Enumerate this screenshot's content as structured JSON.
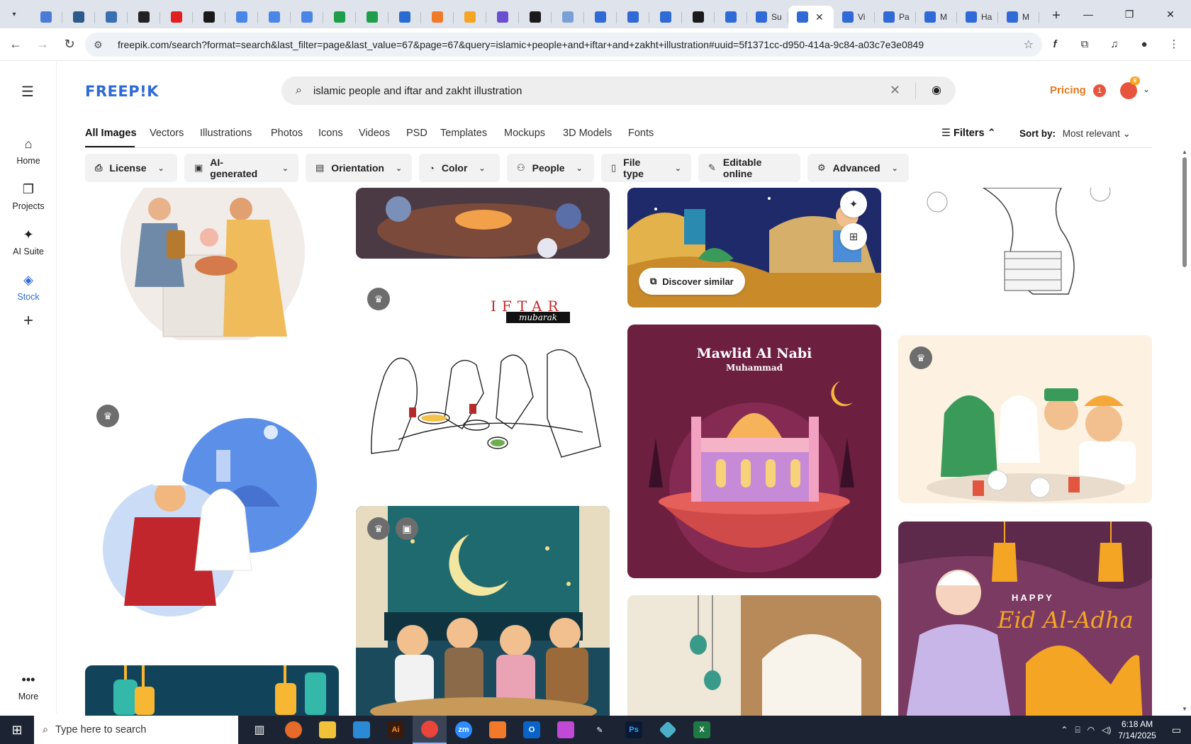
{
  "browser": {
    "tabs": [
      {
        "fav": "#4a7bd6"
      },
      {
        "fav": "#2d5a8a"
      },
      {
        "fav": "#3a6fb0"
      },
      {
        "fav": "#222222"
      },
      {
        "fav": "#e02020"
      },
      {
        "fav": "#1a1a1a"
      },
      {
        "fav": "#4a86e8"
      },
      {
        "fav": "#4a86e8"
      },
      {
        "fav": "#4a86e8"
      },
      {
        "fav": "#1e9e48"
      },
      {
        "fav": "#1e9e48"
      },
      {
        "fav": "#2a6bd1"
      },
      {
        "fav": "#f07a2a"
      },
      {
        "fav": "#f5a524"
      },
      {
        "fav": "#6b4fd1"
      },
      {
        "fav": "#1a1a1a"
      },
      {
        "fav": "#7aa0d8"
      },
      {
        "fav": "#2f6ad6"
      },
      {
        "fav": "#2f6ad6"
      },
      {
        "fav": "#2f6ad6"
      },
      {
        "fav": "#1a1a1a"
      },
      {
        "fav": "#2f6ad6"
      }
    ],
    "titled_tabs": [
      {
        "title": "Su"
      }
    ],
    "active_tab": {
      "title": ""
    },
    "after_tabs": [
      {
        "title": "Vi"
      },
      {
        "title": "Pa"
      },
      {
        "title": "M"
      },
      {
        "title": "Ha"
      },
      {
        "title": "M"
      }
    ],
    "new_tab": "+",
    "url": "freepik.com/search?format=search&last_filter=page&last_value=67&page=67&query=islamic+people+and+iftar+and+zakht+illustration#uuid=5f1371cc-d950-414a-9c84-a03c7e3e0849"
  },
  "sidebar": {
    "items": [
      {
        "label": "Home",
        "icon": "home-icon"
      },
      {
        "label": "Projects",
        "icon": "folder-icon"
      },
      {
        "label": "AI Suite",
        "icon": "sparkle-icon"
      },
      {
        "label": "Stock",
        "icon": "stock-icon"
      }
    ],
    "more": "More"
  },
  "header": {
    "logo": "FREEP!K",
    "search_query": "islamic people and iftar and zakht illustration",
    "pricing": "Pricing",
    "notif_count": "1"
  },
  "categories": [
    "All Images",
    "Vectors",
    "Illustrations",
    "Photos",
    "Icons",
    "Videos",
    "PSD",
    "Templates",
    "Mockups",
    "3D Models",
    "Fonts"
  ],
  "filters_label": "Filters",
  "sort": {
    "label": "Sort by:",
    "value": "Most relevant"
  },
  "chips": [
    {
      "label": "License",
      "icon": "license-icon"
    },
    {
      "label": "AI-generated",
      "icon": "ai-icon"
    },
    {
      "label": "Orientation",
      "icon": "orientation-icon"
    },
    {
      "label": "Color",
      "icon": "palette-icon"
    },
    {
      "label": "People",
      "icon": "people-icon"
    },
    {
      "label": "File type",
      "icon": "file-icon"
    },
    {
      "label": "Editable online",
      "icon": "pencil-icon"
    },
    {
      "label": "Advanced",
      "icon": "gear-icon"
    }
  ],
  "cards": {
    "discover_similar": "Discover similar",
    "iftar_title": "IFTAR",
    "iftar_sub": "mubarak",
    "mawlid_title": "Mawlid Al Nabi",
    "mawlid_sub": "Muhammad",
    "eid_happy": "HAPPY",
    "eid_title": "Eid Al-Adha"
  },
  "taskbar": {
    "search_placeholder": "Type here to search",
    "time": "6:18 AM",
    "date": "7/14/2025"
  },
  "colors": {
    "brand_blue": "#2f6ad6",
    "pricing_orange": "#e07a1f",
    "taskbar_bg": "#1c2433"
  }
}
